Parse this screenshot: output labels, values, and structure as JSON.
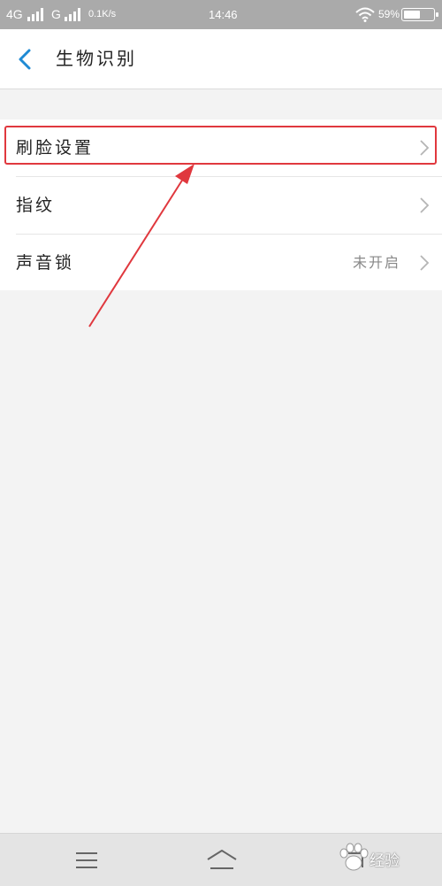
{
  "status_bar": {
    "network1": "4G",
    "network2": "G",
    "speed": "0.1K/s",
    "time": "14:46",
    "battery_percent": "59%",
    "battery_level": 0.59
  },
  "header": {
    "title": "生物识别"
  },
  "settings": {
    "items": [
      {
        "label": "刷脸设置",
        "value": ""
      },
      {
        "label": "指纹",
        "value": ""
      },
      {
        "label": "声音锁",
        "value": "未开启"
      }
    ]
  },
  "watermark": {
    "text": "经验"
  },
  "colors": {
    "accent": "#1f8ad4",
    "annotation": "#e0383e",
    "status_bar": "#aaaaaa",
    "background": "#f3f3f3"
  }
}
